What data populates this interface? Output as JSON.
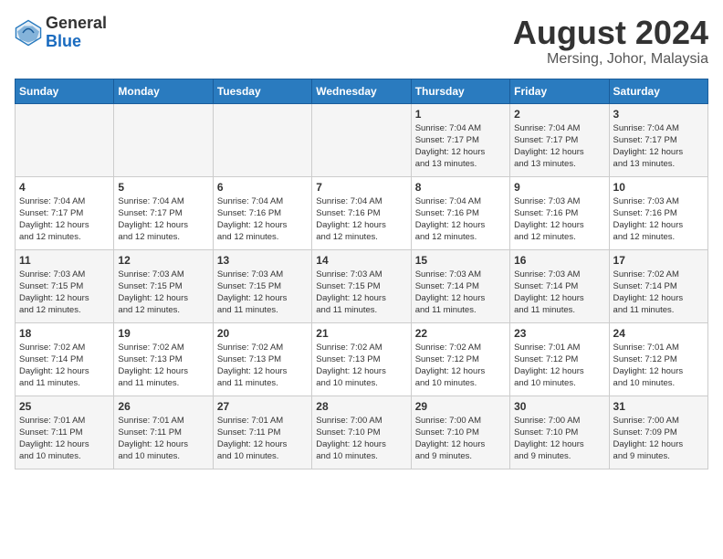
{
  "header": {
    "logo_general": "General",
    "logo_blue": "Blue",
    "title": "August 2024",
    "subtitle": "Mersing, Johor, Malaysia"
  },
  "days_of_week": [
    "Sunday",
    "Monday",
    "Tuesday",
    "Wednesday",
    "Thursday",
    "Friday",
    "Saturday"
  ],
  "weeks": [
    [
      {
        "day": "",
        "info": ""
      },
      {
        "day": "",
        "info": ""
      },
      {
        "day": "",
        "info": ""
      },
      {
        "day": "",
        "info": ""
      },
      {
        "day": "1",
        "info": "Sunrise: 7:04 AM\nSunset: 7:17 PM\nDaylight: 12 hours\nand 13 minutes."
      },
      {
        "day": "2",
        "info": "Sunrise: 7:04 AM\nSunset: 7:17 PM\nDaylight: 12 hours\nand 13 minutes."
      },
      {
        "day": "3",
        "info": "Sunrise: 7:04 AM\nSunset: 7:17 PM\nDaylight: 12 hours\nand 13 minutes."
      }
    ],
    [
      {
        "day": "4",
        "info": "Sunrise: 7:04 AM\nSunset: 7:17 PM\nDaylight: 12 hours\nand 12 minutes."
      },
      {
        "day": "5",
        "info": "Sunrise: 7:04 AM\nSunset: 7:17 PM\nDaylight: 12 hours\nand 12 minutes."
      },
      {
        "day": "6",
        "info": "Sunrise: 7:04 AM\nSunset: 7:16 PM\nDaylight: 12 hours\nand 12 minutes."
      },
      {
        "day": "7",
        "info": "Sunrise: 7:04 AM\nSunset: 7:16 PM\nDaylight: 12 hours\nand 12 minutes."
      },
      {
        "day": "8",
        "info": "Sunrise: 7:04 AM\nSunset: 7:16 PM\nDaylight: 12 hours\nand 12 minutes."
      },
      {
        "day": "9",
        "info": "Sunrise: 7:03 AM\nSunset: 7:16 PM\nDaylight: 12 hours\nand 12 minutes."
      },
      {
        "day": "10",
        "info": "Sunrise: 7:03 AM\nSunset: 7:16 PM\nDaylight: 12 hours\nand 12 minutes."
      }
    ],
    [
      {
        "day": "11",
        "info": "Sunrise: 7:03 AM\nSunset: 7:15 PM\nDaylight: 12 hours\nand 12 minutes."
      },
      {
        "day": "12",
        "info": "Sunrise: 7:03 AM\nSunset: 7:15 PM\nDaylight: 12 hours\nand 12 minutes."
      },
      {
        "day": "13",
        "info": "Sunrise: 7:03 AM\nSunset: 7:15 PM\nDaylight: 12 hours\nand 11 minutes."
      },
      {
        "day": "14",
        "info": "Sunrise: 7:03 AM\nSunset: 7:15 PM\nDaylight: 12 hours\nand 11 minutes."
      },
      {
        "day": "15",
        "info": "Sunrise: 7:03 AM\nSunset: 7:14 PM\nDaylight: 12 hours\nand 11 minutes."
      },
      {
        "day": "16",
        "info": "Sunrise: 7:03 AM\nSunset: 7:14 PM\nDaylight: 12 hours\nand 11 minutes."
      },
      {
        "day": "17",
        "info": "Sunrise: 7:02 AM\nSunset: 7:14 PM\nDaylight: 12 hours\nand 11 minutes."
      }
    ],
    [
      {
        "day": "18",
        "info": "Sunrise: 7:02 AM\nSunset: 7:14 PM\nDaylight: 12 hours\nand 11 minutes."
      },
      {
        "day": "19",
        "info": "Sunrise: 7:02 AM\nSunset: 7:13 PM\nDaylight: 12 hours\nand 11 minutes."
      },
      {
        "day": "20",
        "info": "Sunrise: 7:02 AM\nSunset: 7:13 PM\nDaylight: 12 hours\nand 11 minutes."
      },
      {
        "day": "21",
        "info": "Sunrise: 7:02 AM\nSunset: 7:13 PM\nDaylight: 12 hours\nand 10 minutes."
      },
      {
        "day": "22",
        "info": "Sunrise: 7:02 AM\nSunset: 7:12 PM\nDaylight: 12 hours\nand 10 minutes."
      },
      {
        "day": "23",
        "info": "Sunrise: 7:01 AM\nSunset: 7:12 PM\nDaylight: 12 hours\nand 10 minutes."
      },
      {
        "day": "24",
        "info": "Sunrise: 7:01 AM\nSunset: 7:12 PM\nDaylight: 12 hours\nand 10 minutes."
      }
    ],
    [
      {
        "day": "25",
        "info": "Sunrise: 7:01 AM\nSunset: 7:11 PM\nDaylight: 12 hours\nand 10 minutes."
      },
      {
        "day": "26",
        "info": "Sunrise: 7:01 AM\nSunset: 7:11 PM\nDaylight: 12 hours\nand 10 minutes."
      },
      {
        "day": "27",
        "info": "Sunrise: 7:01 AM\nSunset: 7:11 PM\nDaylight: 12 hours\nand 10 minutes."
      },
      {
        "day": "28",
        "info": "Sunrise: 7:00 AM\nSunset: 7:10 PM\nDaylight: 12 hours\nand 10 minutes."
      },
      {
        "day": "29",
        "info": "Sunrise: 7:00 AM\nSunset: 7:10 PM\nDaylight: 12 hours\nand 9 minutes."
      },
      {
        "day": "30",
        "info": "Sunrise: 7:00 AM\nSunset: 7:10 PM\nDaylight: 12 hours\nand 9 minutes."
      },
      {
        "day": "31",
        "info": "Sunrise: 7:00 AM\nSunset: 7:09 PM\nDaylight: 12 hours\nand 9 minutes."
      }
    ]
  ]
}
